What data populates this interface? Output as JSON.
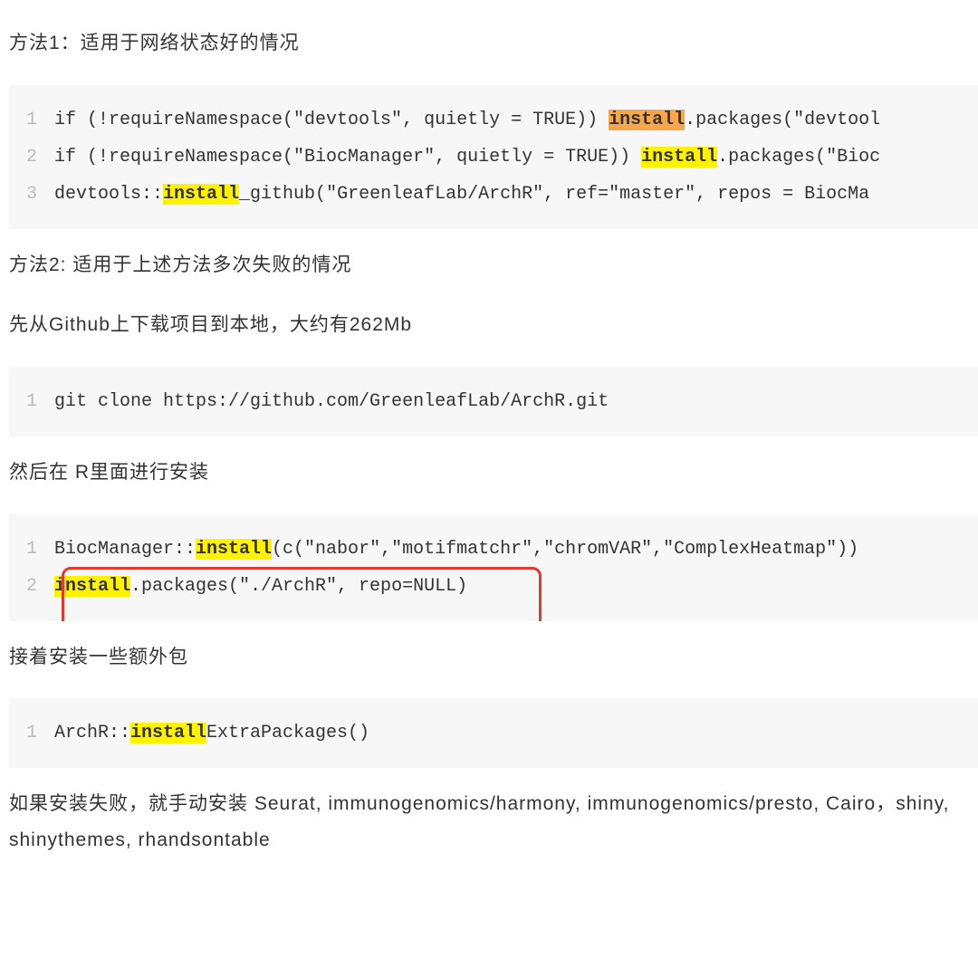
{
  "para1": "方法1：适用于网络状态好的情况",
  "code1": {
    "l1a": "if (!requireNamespace(\"devtools\", quietly = TRUE)) ",
    "l1b": "install",
    "l1c": ".packages(\"devtool",
    "l2a": "if (!requireNamespace(\"BiocManager\", quietly = TRUE)) ",
    "l2b": "install",
    "l2c": ".packages(\"Bioc",
    "l3a": "devtools::",
    "l3b": "install",
    "l3c": "_github(\"GreenleafLab/ArchR\", ref=\"master\", repos = BiocMa"
  },
  "para2": "方法2:  适用于上述方法多次失败的情况",
  "para3": "先从Github上下载项目到本地，大约有262Mb",
  "code2": {
    "l1": "git clone https://github.com/GreenleafLab/ArchR.git"
  },
  "para4": "然后在 R里面进行安装",
  "code3": {
    "l1a": "BiocManager::",
    "l1b": "install",
    "l1c": "(c(\"nabor\",\"motifmatchr\",\"chromVAR\",\"ComplexHeatmap\"))",
    "l2a": "install",
    "l2b": ".packages(\"./ArchR\", repo=NULL)"
  },
  "para5": "接着安装一些额外包",
  "code4": {
    "l1a": "ArchR::",
    "l1b": "install",
    "l1c": "ExtraPackages()"
  },
  "para6": "如果安装失败，就手动安装 Seurat,  immunogenomics/harmony, immunogenomics/presto,   Cairo，shiny,  shinythemes,  rhandsontable",
  "lineNumbers": {
    "n1": "1",
    "n2": "2",
    "n3": "3"
  }
}
